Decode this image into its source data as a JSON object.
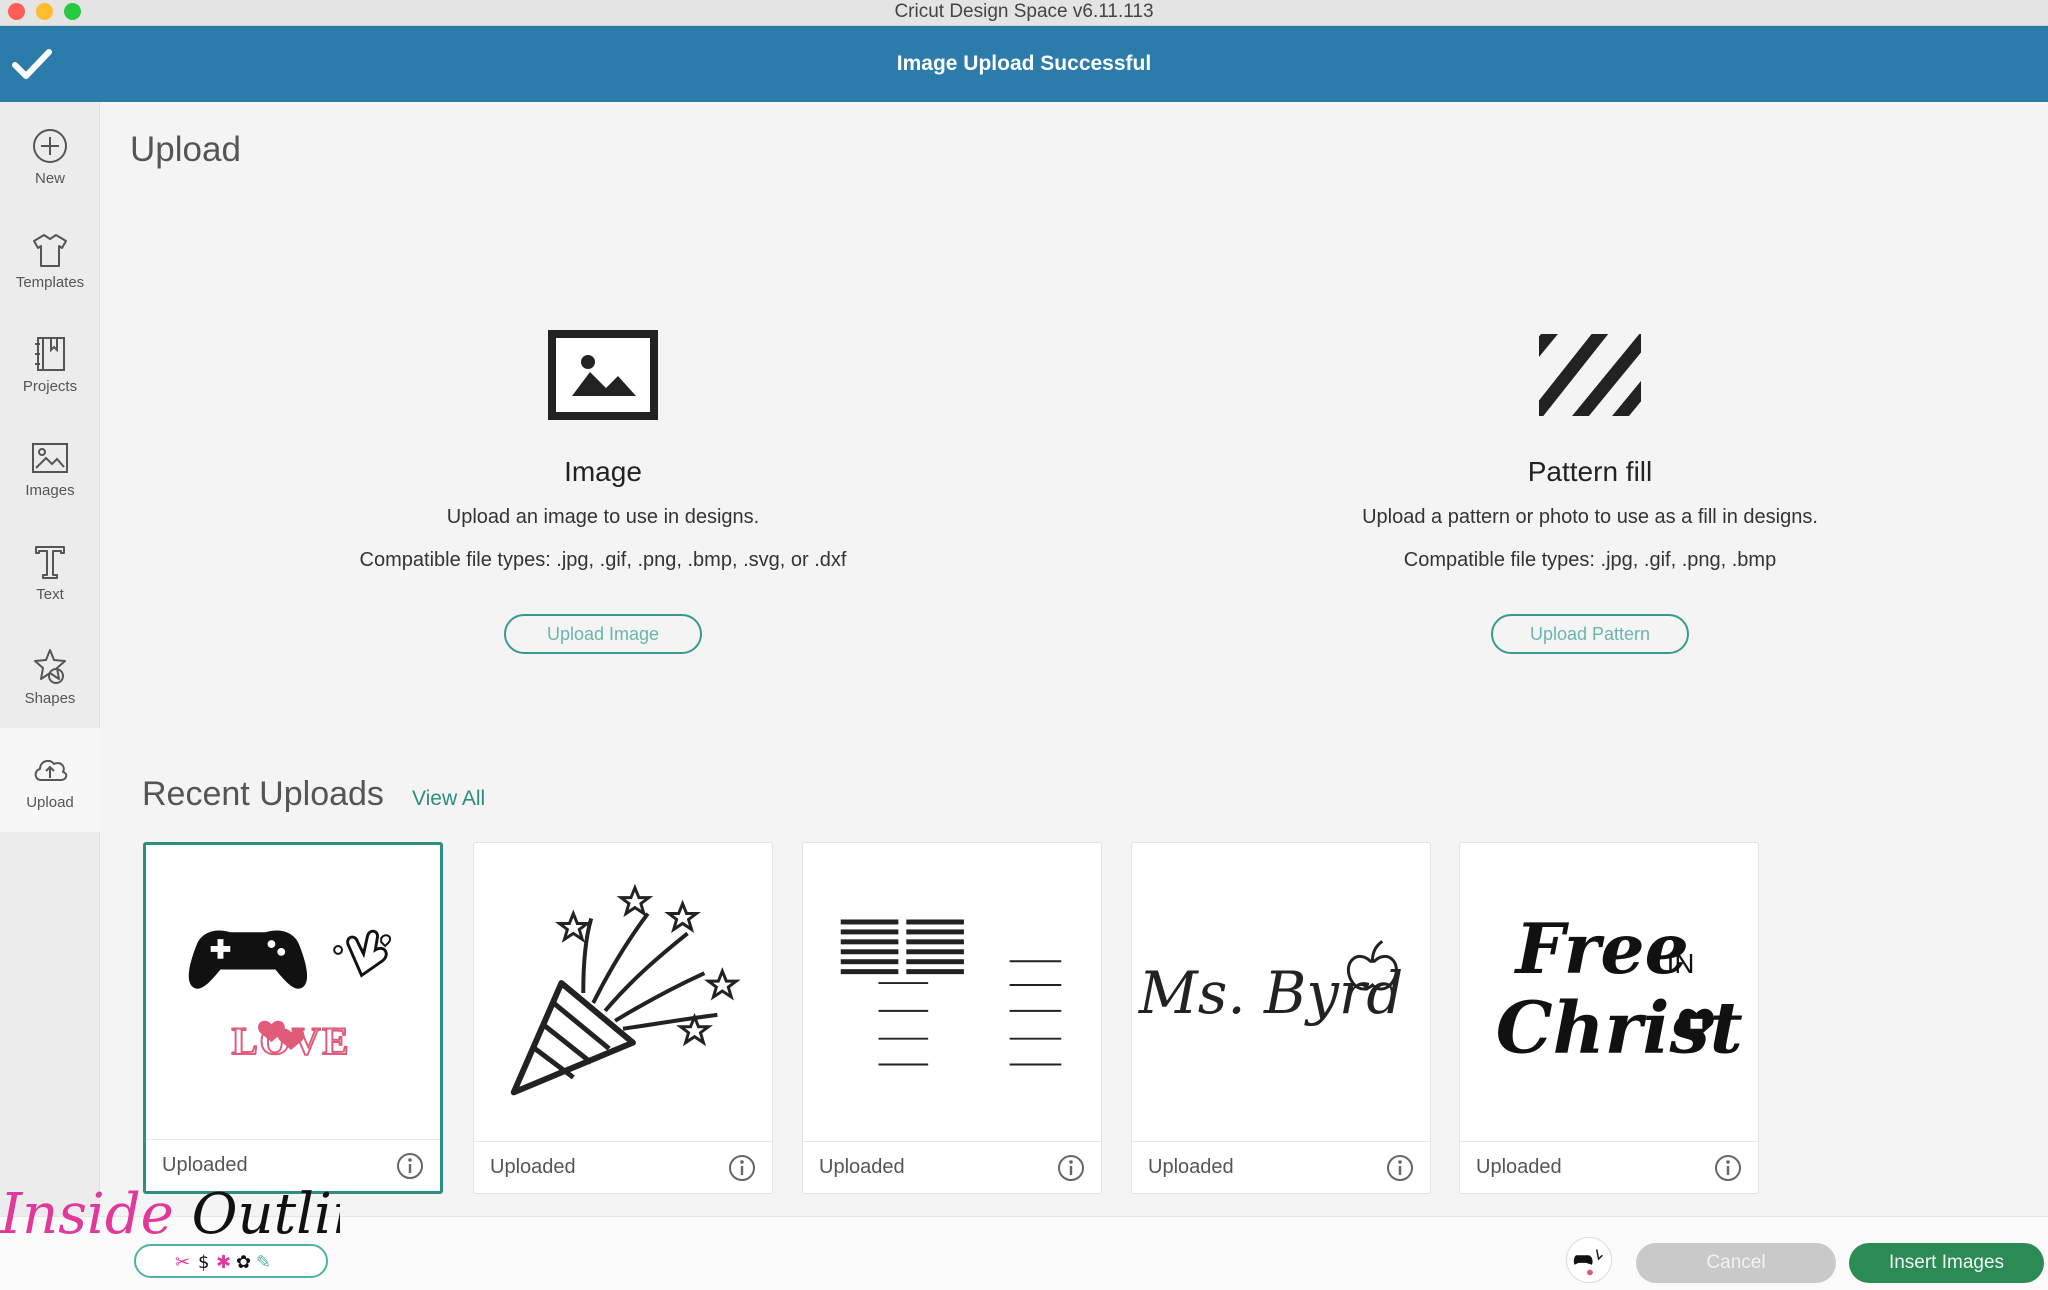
{
  "window": {
    "title": "Cricut Design Space  v6.11.113"
  },
  "banner": {
    "message": "Image Upload Successful"
  },
  "sidebar": {
    "items": [
      {
        "label": "New",
        "icon": "plus-circle-icon"
      },
      {
        "label": "Templates",
        "icon": "tshirt-icon"
      },
      {
        "label": "Projects",
        "icon": "notebook-icon"
      },
      {
        "label": "Images",
        "icon": "image-icon"
      },
      {
        "label": "Text",
        "icon": "text-icon"
      },
      {
        "label": "Shapes",
        "icon": "shapes-icon"
      },
      {
        "label": "Upload",
        "icon": "cloud-upload-icon",
        "active": true
      }
    ]
  },
  "page": {
    "title": "Upload"
  },
  "image_upload": {
    "title": "Image",
    "description": "Upload an image to use in designs.",
    "types": "Compatible file types: .jpg, .gif, .png, .bmp, .svg, or .dxf",
    "button": "Upload Image"
  },
  "pattern_upload": {
    "title": "Pattern fill",
    "description": "Upload a pattern or photo to use as a fill in designs.",
    "types": "Compatible file types: .jpg, .gif, .png, .bmp",
    "button": "Upload Pattern"
  },
  "recent": {
    "title": "Recent Uploads",
    "view_all": "View All",
    "cards": [
      {
        "label": "Uploaded",
        "thumb": "gamer-love-graphic",
        "thumb_text": "LOVE",
        "selected": true
      },
      {
        "label": "Uploaded",
        "thumb": "party-popper-graphic"
      },
      {
        "label": "Uploaded",
        "thumb": "lined-chart-graphic"
      },
      {
        "label": "Uploaded",
        "thumb": "ms-byrd-script-graphic",
        "thumb_text": "Ms. Byrd"
      },
      {
        "label": "Uploaded",
        "thumb": "free-in-christ-graphic",
        "thumb_text_1": "Free",
        "thumb_text_2": "IN",
        "thumb_text_3": "Christ"
      }
    ]
  },
  "footer": {
    "cancel": "Cancel",
    "insert": "Insert Images"
  },
  "watermark": {
    "text": "Inside Outlined"
  },
  "colors": {
    "banner": "#2b7bab",
    "accent": "#2e8c7c",
    "insert": "#2c8a55",
    "love_pink": "#e05a7a"
  }
}
